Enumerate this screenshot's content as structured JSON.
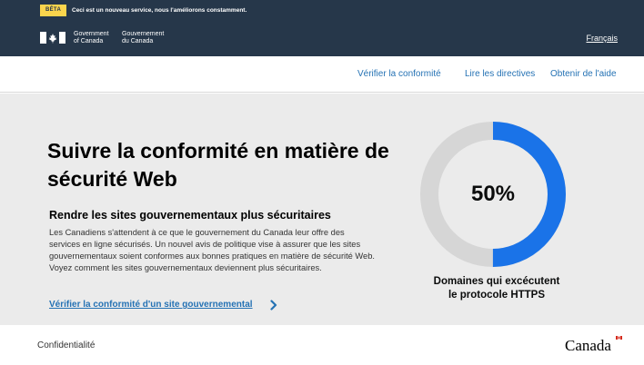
{
  "beta": {
    "badge": "BÊTA",
    "text": "Ceci est un nouveau service, nous l'améliorons constamment."
  },
  "header": {
    "gov_en_line1": "Government",
    "gov_en_line2": "of Canada",
    "gov_fr_line1": "Gouvernement",
    "gov_fr_line2": "du Canada",
    "language_toggle": "Français"
  },
  "nav": {
    "items": [
      {
        "label": "Vérifier la conformité"
      },
      {
        "label": "Lire les directives"
      },
      {
        "label": "Obtenir de l'aide"
      }
    ]
  },
  "hero": {
    "title": "Suivre la conformité en matière de sécurité Web",
    "subtitle": "Rendre les sites gouvernementaux plus sécuritaires",
    "body": "Les Canadiens s'attendent à ce que le gouvernement du Canada leur offre des services en ligne sécurisés. Un nouvel avis de politique vise à assurer que les sites gouvernementaux soient conformes aux bonnes pratiques en matière de sécurité Web. Voyez comment les sites gouvernementaux deviennent plus sécuritaires.",
    "link": "Vérifier la conformité d'un site gouvernemental"
  },
  "donut": {
    "percent_label": "50%",
    "fraction": 0.5,
    "caption_line1": "Domaines qui excécutent",
    "caption_line2": "le protocole HTTPS",
    "fill_color": "#1a73e8",
    "track_color": "#d6d6d6"
  },
  "footer": {
    "privacy": "Confidentialité",
    "wordmark_text": "Canada"
  },
  "colors": {
    "header_bg": "#26374a",
    "beta_badge_bg": "#fbd54d",
    "link": "#2572b4",
    "hero_bg": "#ebebeb",
    "flag_red": "#ffffff"
  }
}
